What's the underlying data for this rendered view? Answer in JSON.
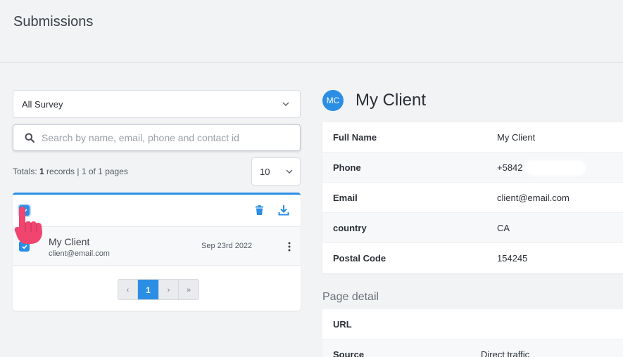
{
  "header": {
    "title": "Submissions"
  },
  "filters": {
    "survey_select": "All Survey",
    "search_placeholder": "Search by name, email, phone and contact id",
    "totals_prefix": "Totals: ",
    "totals_count": "1",
    "totals_suffix": " records | 1 of 1 pages",
    "per_page": "10"
  },
  "list": {
    "rows": [
      {
        "name": "My Client",
        "email": "client@email.com",
        "date": "Sep 23rd 2022",
        "checked": true
      }
    ],
    "master_checked": true
  },
  "pagination": {
    "prev": "‹",
    "current": "1",
    "next": "›",
    "last": "»"
  },
  "client": {
    "initials": "MC",
    "name": "My Client",
    "fields": [
      {
        "label": "Full Name",
        "value": "My Client"
      },
      {
        "label": "Phone",
        "value": "+5842"
      },
      {
        "label": "Email",
        "value": "client@email.com"
      },
      {
        "label": "country",
        "value": "CA"
      },
      {
        "label": "Postal Code",
        "value": "154245"
      }
    ]
  },
  "page_detail": {
    "title": "Page detail",
    "fields": [
      {
        "label": "URL",
        "value": ""
      },
      {
        "label": "Source",
        "value": "Direct traffic"
      }
    ]
  },
  "colors": {
    "accent": "#2b8ee5",
    "pointer": "#f0456e"
  },
  "icons": [
    "chevron-down-icon",
    "search-icon",
    "trash-icon",
    "download-icon",
    "kebab-menu-icon",
    "pointing-hand-icon",
    "checkmark-icon"
  ]
}
